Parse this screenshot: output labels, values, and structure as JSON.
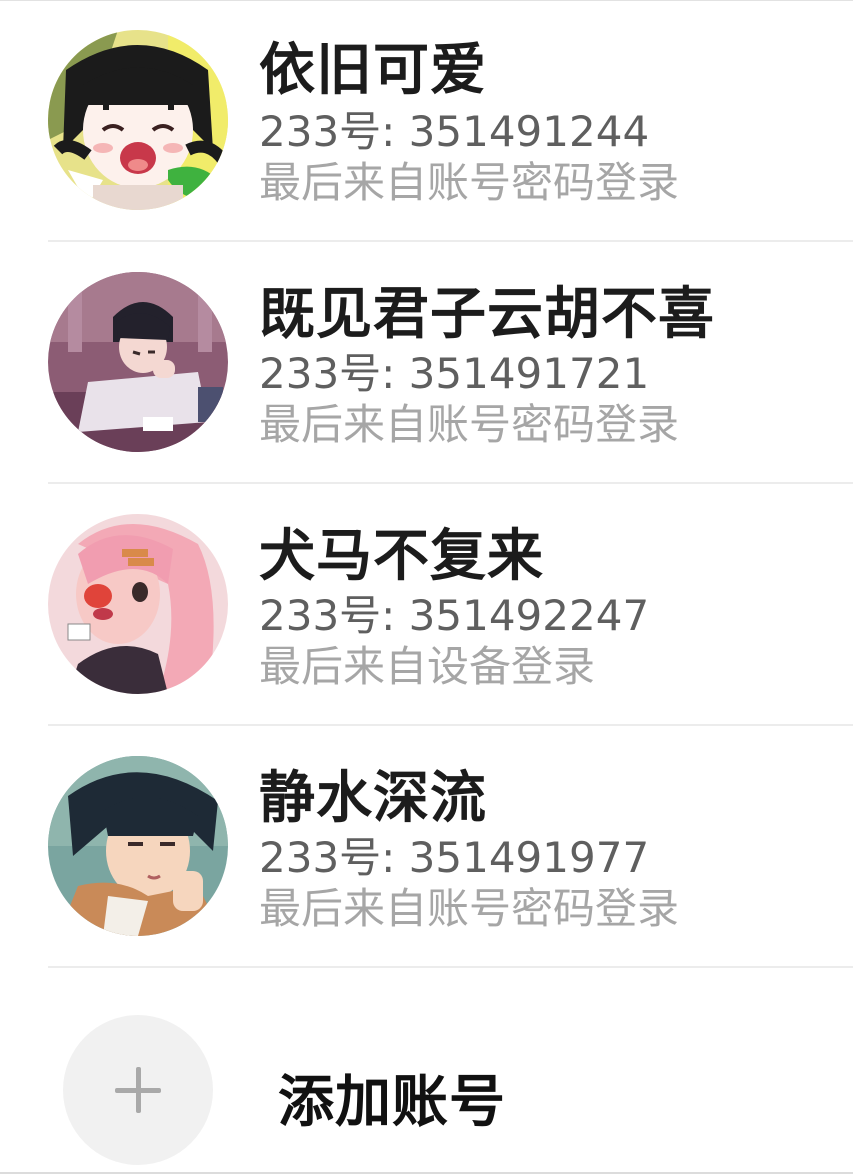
{
  "accounts": [
    {
      "nickname": "依旧可爱",
      "account_id": "233号: 351491244",
      "login_source": "最后来自账号密码登录",
      "avatar_icon": "avatar-anime-girl-black-hair-icon"
    },
    {
      "nickname": "既见君子云胡不喜",
      "account_id": "233号: 351491721",
      "login_source": "最后来自账号密码登录",
      "avatar_icon": "avatar-anime-boy-at-desk-icon"
    },
    {
      "nickname": "犬马不复来",
      "account_id": "233号: 351492247",
      "login_source": "最后来自设备登录",
      "avatar_icon": "avatar-pink-hair-girl-icon"
    },
    {
      "nickname": "静水深流",
      "account_id": "233号: 351491977",
      "login_source": "最后来自账号密码登录",
      "avatar_icon": "avatar-anime-boy-dark-hair-icon"
    }
  ],
  "add_account": {
    "label": "添加账号",
    "icon": "plus-icon"
  },
  "colors": {
    "nickname": "#1c1c1c",
    "account_id": "#5f5f5f",
    "login_source": "#a6a6a6",
    "divider": "#ececec",
    "add_circle_bg": "#f1f1f1",
    "plus": "#a9a9a9"
  }
}
